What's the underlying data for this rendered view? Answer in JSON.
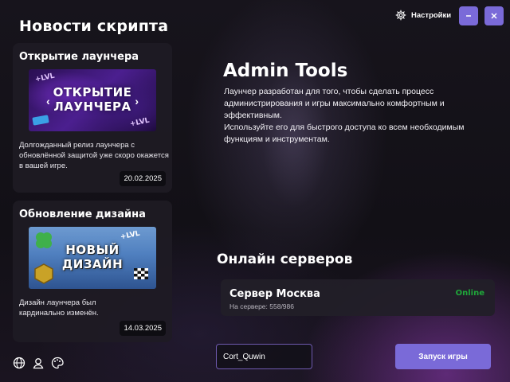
{
  "news": {
    "title": "Новости скрипта",
    "items": [
      {
        "title": "Открытие лаунчера",
        "image_text": "ОТКРЫТИЕ ЛАУНЧЕРА",
        "image_line1": "ОТКРЫТИЕ",
        "image_line2": "ЛАУНЧЕРА",
        "image_badge": "+LVL",
        "description": "Долгожданный релиз лаунчера с обновлённой защитой уже скоро окажется в вашей игре.",
        "date": "20.02.2025"
      },
      {
        "title": "Обновление дизайна",
        "image_line1": "НОВЫЙ",
        "image_line2": "ДИЗАЙН",
        "image_badge": "+LVL",
        "description": "Дизайн лаунчера был кардинально изменён.",
        "date": "14.03.2025"
      }
    ]
  },
  "hero": {
    "title": "Admin Tools",
    "description_1": "Лаунчер разработан для того, чтобы сделать процесс администрирования и игры максимально комфортным и эффективным.",
    "description_2": "Используйте его для быстрого доступа ко всем необходимым функциям и инструментам."
  },
  "servers": {
    "title": "Онлайн серверов",
    "items": [
      {
        "name": "Сервер Москва",
        "players": "На сервере: 558/986",
        "status": "Online"
      }
    ]
  },
  "footer": {
    "nickname_value": "Cort_Quwin",
    "play_label": "Запуск игры"
  },
  "header": {
    "settings_label": "Настройки",
    "minimize_icon": "minimize-icon",
    "close_icon": "close-icon"
  },
  "bottom_icons": [
    "globe-icon",
    "profile-icon",
    "palette-icon"
  ],
  "colors": {
    "accent": "#7a6ad8",
    "online": "#1fa83a",
    "card_bg": "#1e1b24"
  }
}
